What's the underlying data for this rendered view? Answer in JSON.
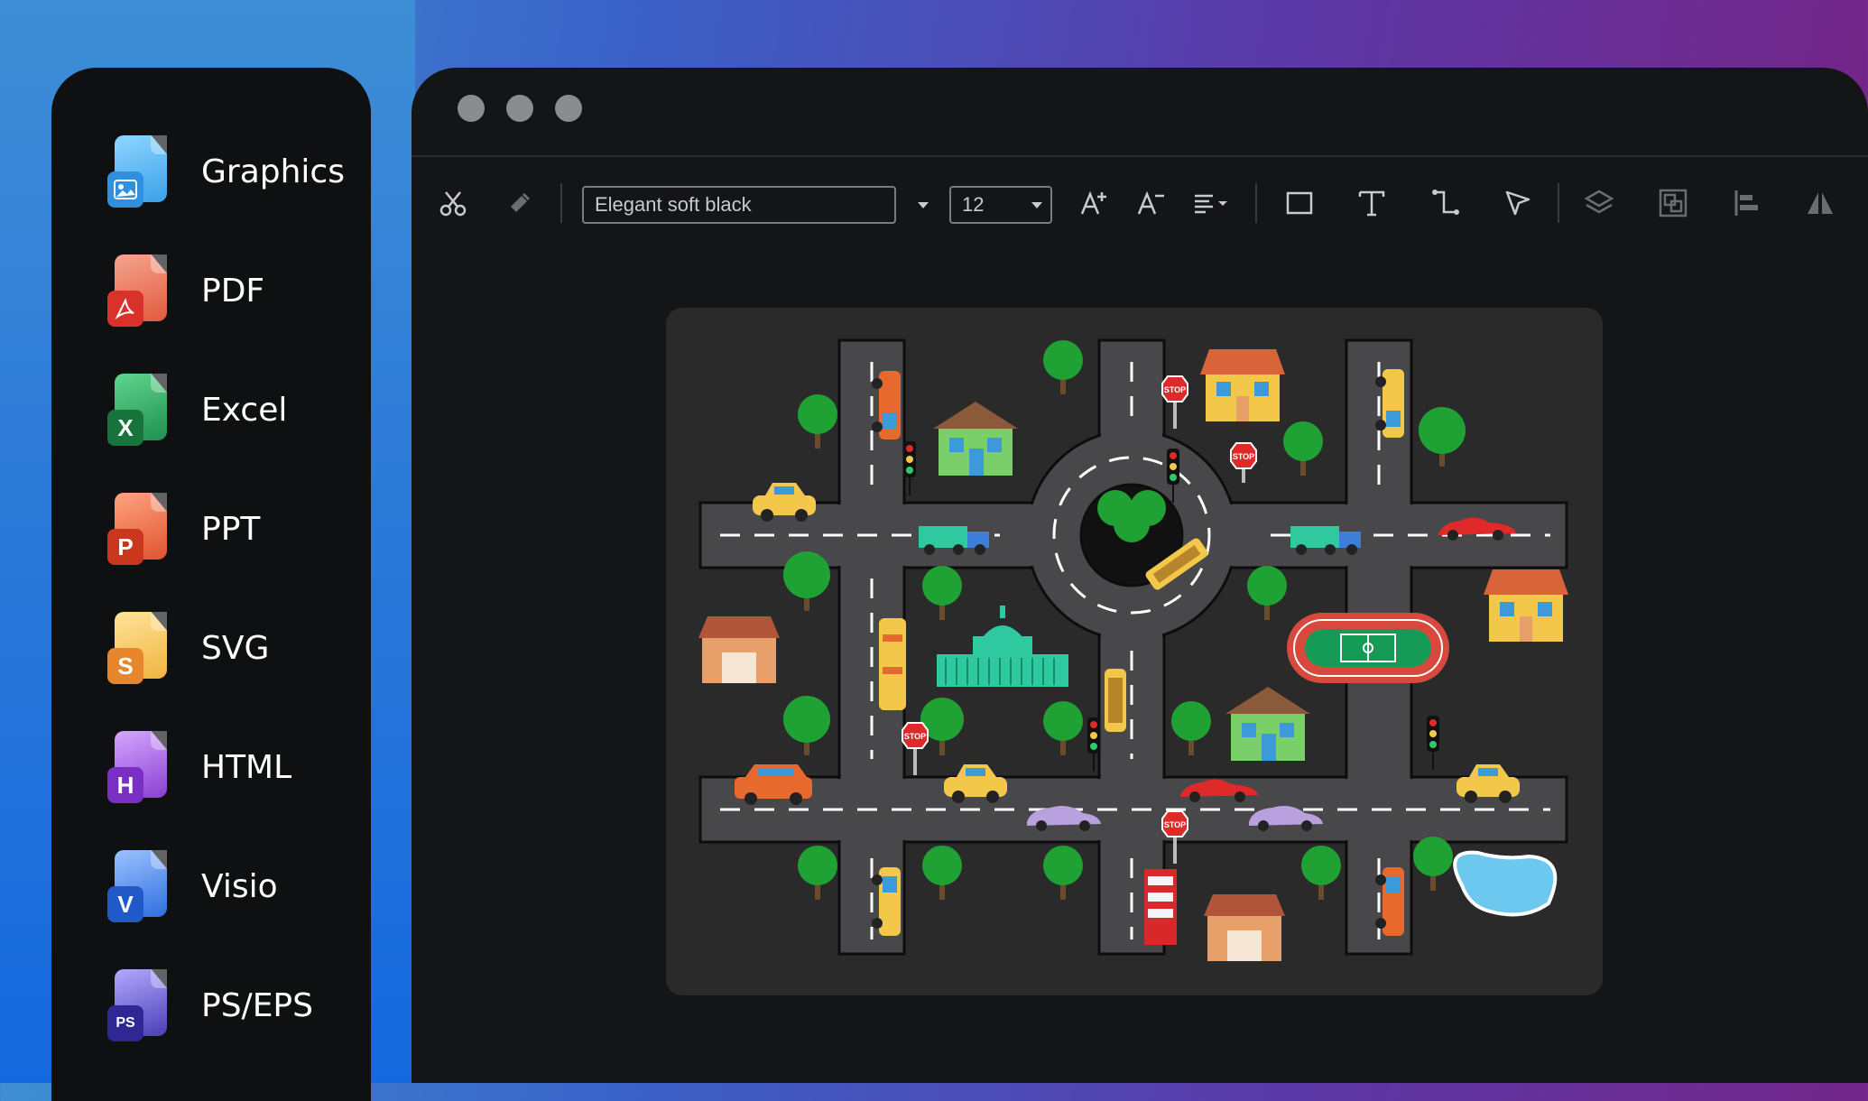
{
  "sidebar": {
    "items": [
      {
        "label": "Graphics",
        "icon": "graphics-file-icon",
        "badge": "",
        "color": "#5bb8f0"
      },
      {
        "label": "PDF",
        "icon": "pdf-file-icon",
        "badge": "",
        "color": "#e04a3c"
      },
      {
        "label": "Excel",
        "icon": "excel-file-icon",
        "badge": "X",
        "color": "#1f8f4e"
      },
      {
        "label": "PPT",
        "icon": "ppt-file-icon",
        "badge": "P",
        "color": "#e0532f"
      },
      {
        "label": "SVG",
        "icon": "svg-file-icon",
        "badge": "S",
        "color": "#f0a032"
      },
      {
        "label": "HTML",
        "icon": "html-file-icon",
        "badge": "H",
        "color": "#8a3fd1"
      },
      {
        "label": "Visio",
        "icon": "visio-file-icon",
        "badge": "V",
        "color": "#2f6fe0"
      },
      {
        "label": "PS/EPS",
        "icon": "ps-file-icon",
        "badge": "PS",
        "color": "#4a3fb5"
      }
    ]
  },
  "toolbar": {
    "font_name": "Elegant soft black",
    "font_size": "12",
    "tools": [
      "scissors-icon",
      "format-painter-icon",
      "increase-font-icon",
      "decrease-font-icon",
      "align-icon",
      "rectangle-icon",
      "text-icon",
      "connector-icon",
      "pointer-icon",
      "layers-icon",
      "group-icon",
      "align-left-icon",
      "flip-icon"
    ]
  },
  "diagram": {
    "title": "",
    "stop_sign_text": "STOP",
    "colors": {
      "panel": "#2a2a2b",
      "road": "#4a4a4d",
      "tree": "#1fa233",
      "field": "#169b56",
      "track": "#d8493d"
    }
  }
}
